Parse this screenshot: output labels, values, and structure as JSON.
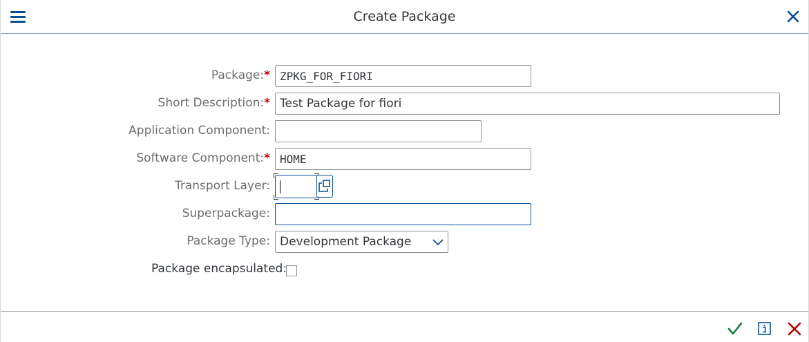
{
  "dialog": {
    "title": "Create Package"
  },
  "colors": {
    "accent": "#0a4f94",
    "required": "#bb0000",
    "confirm": "#107e3e",
    "cancel": "#bb0000",
    "label": "#6a6d70"
  },
  "icons": {
    "menu": "menu-icon",
    "close": "close-icon",
    "value_help": "value-help-icon",
    "dropdown": "chevron-down-icon",
    "confirm": "checkmark-icon",
    "info": "info-icon",
    "cancel": "cancel-icon"
  },
  "form": {
    "package": {
      "label": "Package:",
      "required": "*",
      "value": "ZPKG_FOR_FIORI"
    },
    "short_description": {
      "label": "Short Description:",
      "required": "*",
      "value": "Test Package for fiori"
    },
    "application_component": {
      "label": "Application Component:",
      "value": ""
    },
    "software_component": {
      "label": "Software Component:",
      "required": "*",
      "value": "HOME"
    },
    "transport_layer": {
      "label": "Transport Layer:",
      "value": ""
    },
    "superpackage": {
      "label": "Superpackage:",
      "value": ""
    },
    "package_type": {
      "label": "Package Type:",
      "value": "Development Package"
    },
    "package_encapsulated": {
      "label": "Package encapsulated:",
      "checked": false
    }
  }
}
